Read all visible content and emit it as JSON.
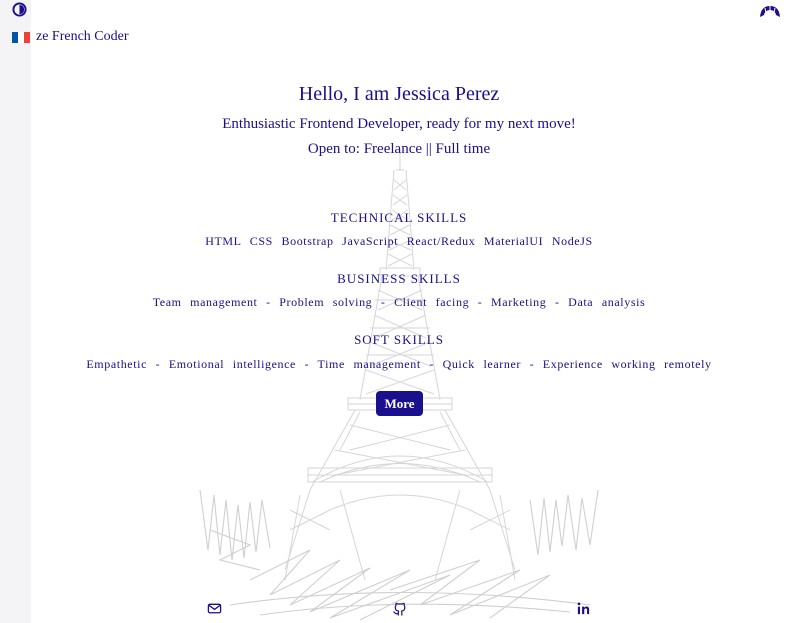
{
  "header": {
    "brand_text": "ze French Coder",
    "theme_toggle_icon": "half-moon-icon",
    "croissant_icon": "croissant-icon",
    "flag_colors": [
      "#0055a4",
      "#ffffff",
      "#ef4135"
    ]
  },
  "hero": {
    "greeting": "Hello, I am Jessica Perez",
    "tagline": "Enthusiastic Frontend Developer, ready for my next move!",
    "open_to": "Open to: Freelance || Full time"
  },
  "skills": {
    "technical": {
      "title": "TECHNICAL SKILLS",
      "items": "HTML  CSS  Bootstrap  JavaScript  React/Redux  MaterialUI  NodeJS"
    },
    "business": {
      "title": "BUSINESS SKILLS",
      "items": "Team management  -  Problem solving  -  Client facing  -  Marketing  -  Data analysis"
    },
    "soft": {
      "title": "SOFT SKILLS",
      "items": "Empathetic  -  Emotional intelligence  -  Time management  -  Quick learner  -  Experience working remotely"
    }
  },
  "more_button": {
    "label": "More"
  },
  "footer": {
    "icons": [
      "mail-icon",
      "github-icon",
      "linkedin-icon"
    ]
  },
  "colors": {
    "accent": "#1a0f8c",
    "sketch": "#c8c8cc"
  }
}
